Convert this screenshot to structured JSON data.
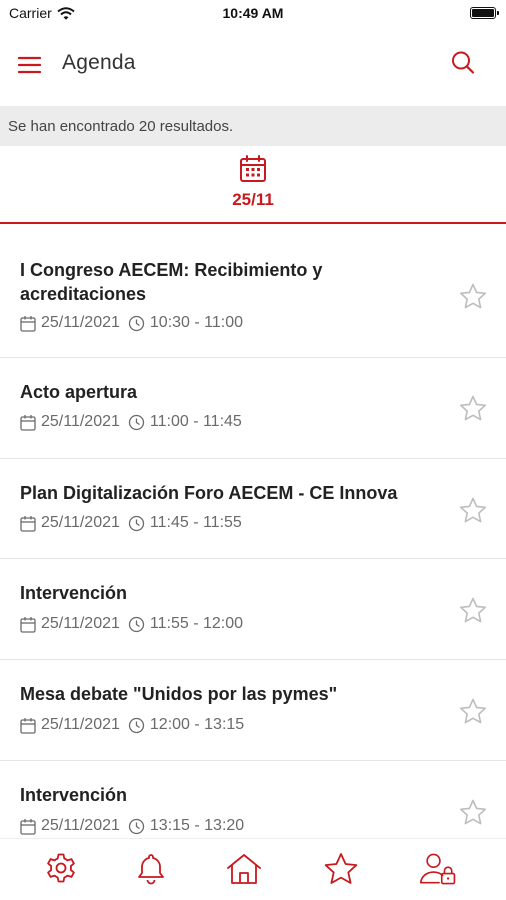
{
  "status_bar": {
    "carrier": "Carrier",
    "time": "10:49 AM"
  },
  "header": {
    "title": "Agenda",
    "menu_icon": "hamburger-icon",
    "search_icon": "search-icon"
  },
  "results": {
    "text": "Se han encontrado 20 resultados."
  },
  "date_tabs": [
    {
      "label": "25/11",
      "icon": "calendar-icon",
      "selected": true
    }
  ],
  "events": [
    {
      "title": "I Congreso AECEM: Recibimiento y acreditaciones",
      "date": "25/11/2021",
      "time": "10:30 - 11:00",
      "favorite": false
    },
    {
      "title": "Acto apertura",
      "date": "25/11/2021",
      "time": "11:00 - 11:45",
      "favorite": false
    },
    {
      "title": "Plan Digitalización Foro AECEM - CE Innova",
      "date": "25/11/2021",
      "time": "11:45 - 11:55",
      "favorite": false
    },
    {
      "title": "Intervención",
      "date": "25/11/2021",
      "time": "11:55 - 12:00",
      "favorite": false
    },
    {
      "title": "Mesa debate \"Unidos por las pymes\"",
      "date": "25/11/2021",
      "time": "12:00 - 13:15",
      "favorite": false
    },
    {
      "title": "Intervención",
      "date": "25/11/2021",
      "time": "13:15 - 13:20",
      "favorite": false
    }
  ],
  "bottom_nav": [
    {
      "icon": "gear-icon",
      "name": "nav-settings"
    },
    {
      "icon": "bell-icon",
      "name": "nav-notifications"
    },
    {
      "icon": "home-icon",
      "name": "nav-home"
    },
    {
      "icon": "star-icon",
      "name": "nav-favorites"
    },
    {
      "icon": "user-lock-icon",
      "name": "nav-account"
    }
  ],
  "colors": {
    "accent": "#c8191f",
    "results_bar_bg": "#ececec",
    "meta_text": "#6a6a6a",
    "star_outline": "#bdbdbd"
  }
}
